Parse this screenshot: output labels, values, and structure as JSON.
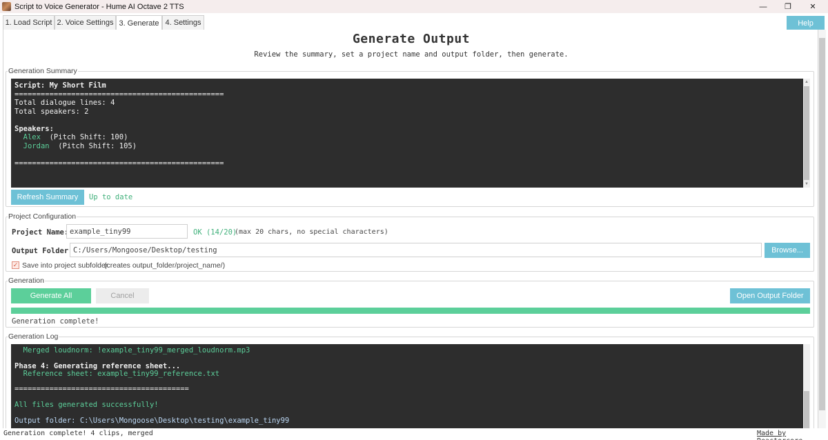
{
  "window": {
    "title": "Script to Voice Generator - Hume AI Octave 2 TTS",
    "minimize": "—",
    "maximize": "❐",
    "close": "✕"
  },
  "tabs": [
    {
      "label": "1. Load Script"
    },
    {
      "label": "2. Voice Settings"
    },
    {
      "label": "3. Generate"
    },
    {
      "label": "4. Settings"
    }
  ],
  "help_label": "Help",
  "header": {
    "title": "Generate Output",
    "subtitle": "Review the summary, set a project name and output folder, then generate."
  },
  "summary": {
    "legend": "Generation Summary",
    "script_line": "Script: My Short Film",
    "rule": "================================================",
    "total_lines": "Total dialogue lines: 4",
    "total_speakers": "Total speakers: 2",
    "speakers_label": "Speakers:",
    "speakers": [
      {
        "name": "Alex",
        "detail": "(Pitch Shift: 100)"
      },
      {
        "name": "Jordan",
        "detail": "(Pitch Shift: 105)"
      }
    ],
    "refresh_label": "Refresh Summary",
    "refresh_status": "Up to date"
  },
  "project": {
    "legend": "Project Configuration",
    "name_label": "Project Name:",
    "name_value": "example_tiny99",
    "name_status": "OK (14/20)",
    "name_hint": "(max 20 chars, no special characters)",
    "folder_label": "Output Folder:",
    "folder_value": "C:/Users/Mongoose/Desktop/testing",
    "browse_label": "Browse...",
    "subfolder_label": "Save into project subfolder",
    "subfolder_hint": "(creates  output_folder/project_name/)",
    "subfolder_checked": true,
    "check_glyph": "✓"
  },
  "generation": {
    "legend": "Generation",
    "generate_label": "Generate All",
    "cancel_label": "Cancel",
    "open_folder_label": "Open Output Folder",
    "progress": 1.0,
    "status": "Generation complete!"
  },
  "log": {
    "legend": "Generation Log",
    "lines": {
      "merged": "  Merged loudnorm: !example_tiny99_merged_loudnorm.mp3",
      "phase4": "Phase 4: Generating reference sheet...",
      "reference": "  Reference sheet: example_tiny99_reference.txt",
      "rule": "========================================",
      "success": "All files generated successfully!",
      "output": "Output folder: C:\\Users\\Mongoose\\Desktop\\testing\\example_tiny99"
    }
  },
  "statusbar": {
    "left": "Generation complete! 4 clips, merged",
    "right": "Made by Reactorcore"
  }
}
